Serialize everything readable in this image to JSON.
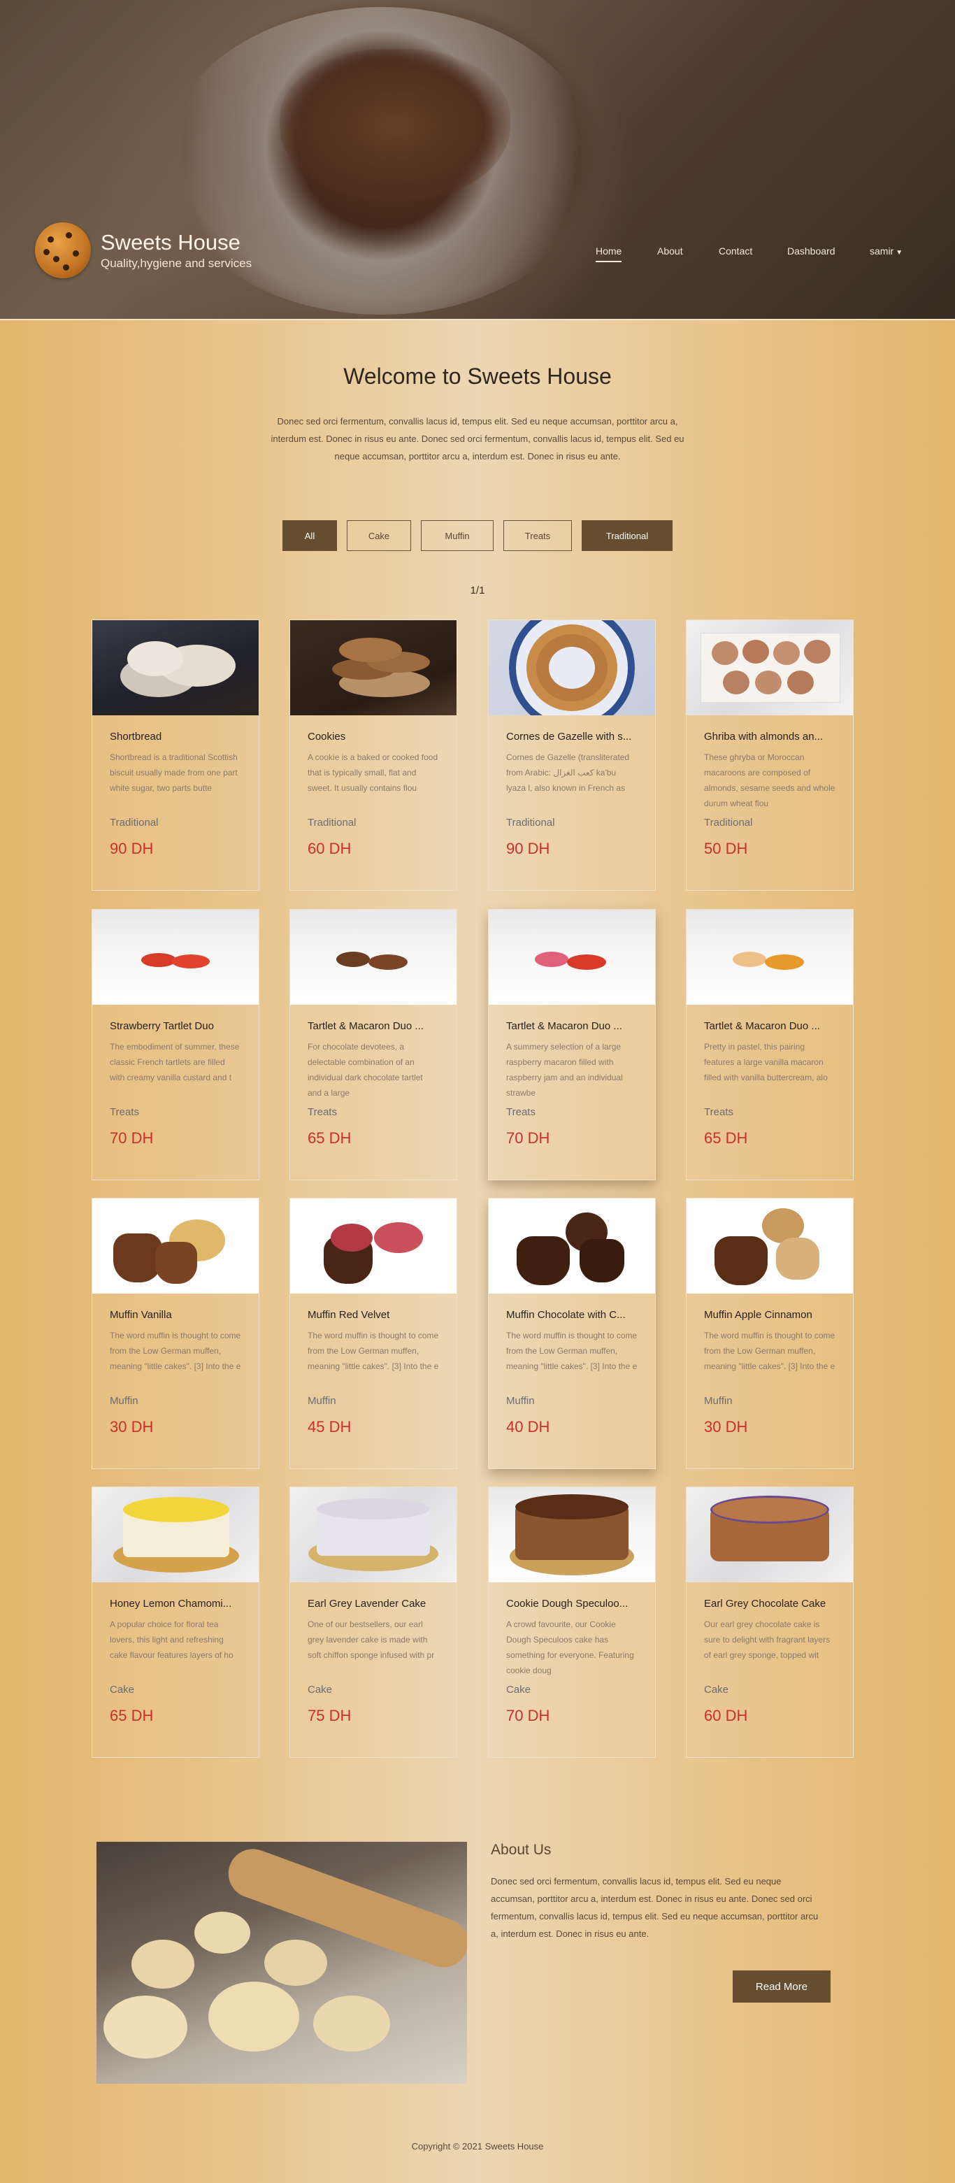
{
  "brand": {
    "title": "Sweets House",
    "tagline": "Quality,hygiene and services"
  },
  "nav": {
    "items": [
      "Home",
      "About",
      "Contact",
      "Dashboard"
    ],
    "user": "samir"
  },
  "welcome": {
    "title": "Welcome to Sweets House",
    "text": "Donec sed orci fermentum, convallis lacus id, tempus elit. Sed eu neque accumsan, porttitor arcu a, interdum est. Donec in risus eu ante. Donec sed orci fermentum, convallis lacus id, tempus elit. Sed eu neque accumsan, porttitor arcu a, interdum est. Donec in risus eu ante."
  },
  "filters": [
    "All",
    "Cake",
    "Muffin",
    "Treats",
    "Traditional"
  ],
  "pagination": "1/1",
  "products": [
    {
      "name": "Shortbread",
      "desc": "Shortbread is a traditional Scottish biscuit usually made from one part white sugar, two parts butte",
      "category": "Traditional",
      "price": "90 DH"
    },
    {
      "name": "Cookies",
      "desc": "A cookie is a baked or cooked food that is typically small, flat and sweet. It usually contains flou",
      "category": "Traditional",
      "price": "60 DH"
    },
    {
      "name": "Cornes de Gazelle with s...",
      "desc": " Cornes de Gazelle (transliterated from Arabic: كعب الغزال ka'bu lyaza l, also known in French as",
      "category": "Traditional",
      "price": "90 DH"
    },
    {
      "name": "Ghriba with almonds an...",
      "desc": "These ghryba or Moroccan macaroons are composed of almonds, sesame seeds and whole durum wheat flou",
      "category": "Traditional",
      "price": "50 DH"
    },
    {
      "name": "Strawberry Tartlet Duo",
      "desc": "The embodiment of summer, these classic French tartlets are filled with creamy vanilla custard and t",
      "category": "Treats",
      "price": "70 DH"
    },
    {
      "name": "Tartlet & Macaron Duo ...",
      "desc": "For chocolate devotees, a delectable combination of an individual dark chocolate tartlet and a large",
      "category": "Treats",
      "price": "65 DH"
    },
    {
      "name": "Tartlet & Macaron Duo ...",
      "desc": "A summery selection of a large raspberry macaron filled with raspberry jam and an individual strawbe",
      "category": "Treats",
      "price": "70 DH"
    },
    {
      "name": "Tartlet & Macaron Duo ...",
      "desc": "Pretty in pastel, this pairing features a large vanilla macaron filled with vanilla buttercream, alo",
      "category": "Treats",
      "price": "65 DH"
    },
    {
      "name": "Muffin Vanilla",
      "desc": "The word muffin is thought to come from the Low German muffen, meaning \"little cakes\". [3] Into the e",
      "category": "Muffin",
      "price": "30 DH"
    },
    {
      "name": "Muffin Red Velvet",
      "desc": "The word muffin is thought to come from the Low German muffen, meaning \"little cakes\". [3] Into the e",
      "category": "Muffin",
      "price": "45 DH"
    },
    {
      "name": "Muffin Chocolate with C...",
      "desc": "The word muffin is thought to come from the Low German muffen, meaning \"little cakes\". [3] Into the e",
      "category": "Muffin",
      "price": "40 DH"
    },
    {
      "name": "Muffin Apple Cinnamon",
      "desc": "The word muffin is thought to come from the Low German muffen, meaning \"little cakes\". [3] Into the e",
      "category": "Muffin",
      "price": "30 DH"
    },
    {
      "name": "Honey Lemon Chamomi...",
      "desc": "A popular choice for floral tea lovers, this light and refreshing cake flavour features layers of ho",
      "category": "Cake",
      "price": "65 DH"
    },
    {
      "name": "Earl Grey Lavender Cake",
      "desc": "One of our bestsellers, our earl grey lavender cake is made with soft chiffon sponge infused with pr",
      "category": "Cake",
      "price": "75 DH"
    },
    {
      "name": "Cookie Dough Speculoo...",
      "desc": "A crowd favourite, our Cookie Dough Speculoos cake has something for everyone. Featuring cookie doug",
      "category": "Cake",
      "price": "70 DH"
    },
    {
      "name": "Earl Grey Chocolate Cake",
      "desc": "Our earl grey chocolate cake is sure to delight with fragrant layers of earl grey sponge, topped wit",
      "category": "Cake",
      "price": "60 DH"
    }
  ],
  "about": {
    "title": "About Us",
    "text": "Donec sed orci fermentum, convallis lacus id, tempus elit. Sed eu neque accumsan, porttitor arcu a, interdum est. Donec in risus eu ante. Donec sed orci fermentum, convallis lacus id, tempus elit. Sed eu neque accumsan, porttitor arcu a, interdum est. Donec in risus eu ante.",
    "button": "Read More"
  },
  "footer": "Copyright © 2021 Sweets House"
}
